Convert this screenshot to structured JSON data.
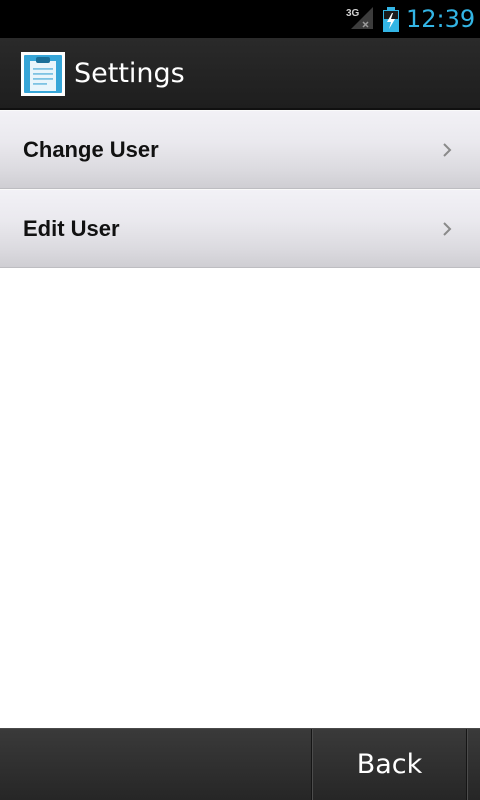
{
  "status_bar": {
    "network_label": "3G",
    "time": "12:39",
    "accent_color": "#33b5e5"
  },
  "action_bar": {
    "icon": "clipboard-icon",
    "title": "Settings"
  },
  "list": {
    "items": [
      {
        "label": "Change User",
        "icon": "chevron-right-icon"
      },
      {
        "label": "Edit User",
        "icon": "chevron-right-icon"
      }
    ]
  },
  "bottom_bar": {
    "back_label": "Back"
  }
}
